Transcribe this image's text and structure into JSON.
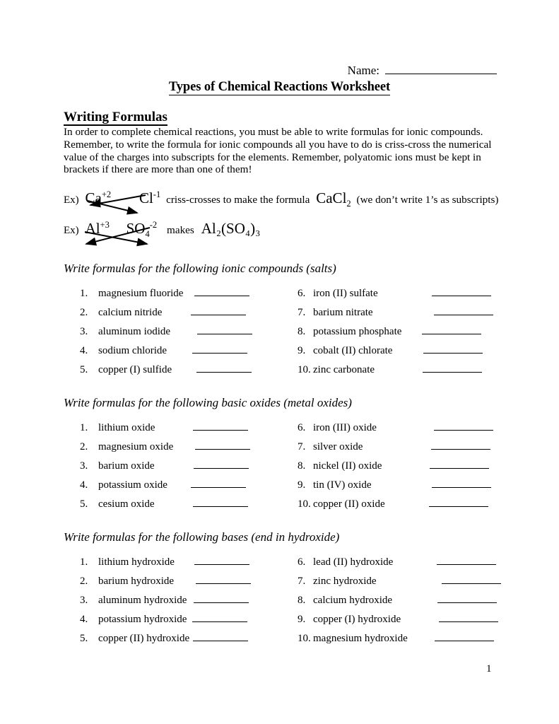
{
  "header": {
    "name_label": "Name:",
    "title": "Types of Chemical Reactions Worksheet"
  },
  "writing_formulas": {
    "heading": "Writing Formulas",
    "intro": "In order to complete chemical reactions, you must be able to write formulas for ionic compounds.  Remember, to write the formula for ionic compounds all you have to do is criss-cross the numerical value of the charges into subscripts for the elements.  Remember, polyatomic ions must be kept in brackets if there are more than one of them!"
  },
  "examples": [
    {
      "label": "Ex)",
      "cation": "Ca",
      "cation_charge": "+2",
      "anion": "Cl",
      "anion_charge": "-1",
      "connector": "criss-crosses to make the formula",
      "result_prefix": "CaCl",
      "result_sub": "2",
      "note": "(we don’t write 1’s as subscripts)"
    },
    {
      "label": "Ex)",
      "cation": "Al",
      "cation_charge": "+3",
      "anion": "SO",
      "anion_sub": "4",
      "anion_charge": "-2",
      "connector": "makes",
      "result": "Al₂(SO₄)₃"
    }
  ],
  "sections": [
    {
      "heading": "Write formulas for the following ionic compounds (salts)",
      "left": [
        {
          "num": "1.",
          "text": "magnesium fluoride"
        },
        {
          "num": "2.",
          "text": "calcium nitride"
        },
        {
          "num": "3.",
          "text": "aluminum iodide"
        },
        {
          "num": "4.",
          "text": "sodium chloride"
        },
        {
          "num": "5.",
          "text": "copper (I) sulfide"
        }
      ],
      "right": [
        {
          "num": "6.",
          "text": "iron (II) sulfate"
        },
        {
          "num": "7.",
          "text": "barium nitrate"
        },
        {
          "num": "8.",
          "text": "potassium phosphate"
        },
        {
          "num": "9.",
          "text": "cobalt (II) chlorate"
        },
        {
          "num": "10.",
          "text": "zinc carbonate"
        }
      ]
    },
    {
      "heading": "Write formulas for the following basic oxides (metal oxides)",
      "left": [
        {
          "num": "1.",
          "text": "lithium oxide"
        },
        {
          "num": "2.",
          "text": "magnesium oxide"
        },
        {
          "num": "3.",
          "text": "barium oxide"
        },
        {
          "num": "4.",
          "text": "potassium oxide"
        },
        {
          "num": "5.",
          "text": "cesium oxide"
        }
      ],
      "right": [
        {
          "num": "6.",
          "text": "iron (III) oxide"
        },
        {
          "num": "7.",
          "text": "silver oxide"
        },
        {
          "num": "8.",
          "text": "nickel (II) oxide"
        },
        {
          "num": "9.",
          "text": "tin (IV) oxide"
        },
        {
          "num": "10.",
          "text": "copper (II) oxide"
        }
      ]
    },
    {
      "heading": "Write formulas for the following bases (end in hydroxide)",
      "left": [
        {
          "num": "1.",
          "text": "lithium hydroxide"
        },
        {
          "num": "2.",
          "text": "barium hydroxide"
        },
        {
          "num": "3.",
          "text": "aluminum hydroxide"
        },
        {
          "num": "4.",
          "text": "potassium hydroxide"
        },
        {
          "num": "5.",
          "text": "copper (II) hydroxide"
        }
      ],
      "right": [
        {
          "num": "6.",
          "text": "lead (II) hydroxide"
        },
        {
          "num": "7.",
          "text": "zinc hydroxide"
        },
        {
          "num": "8.",
          "text": "calcium hydroxide"
        },
        {
          "num": "9.",
          "text": "copper (I) hydroxide"
        },
        {
          "num": "10.",
          "text": "magnesium hydroxide"
        }
      ]
    }
  ],
  "footer": {
    "page_number": "1"
  }
}
